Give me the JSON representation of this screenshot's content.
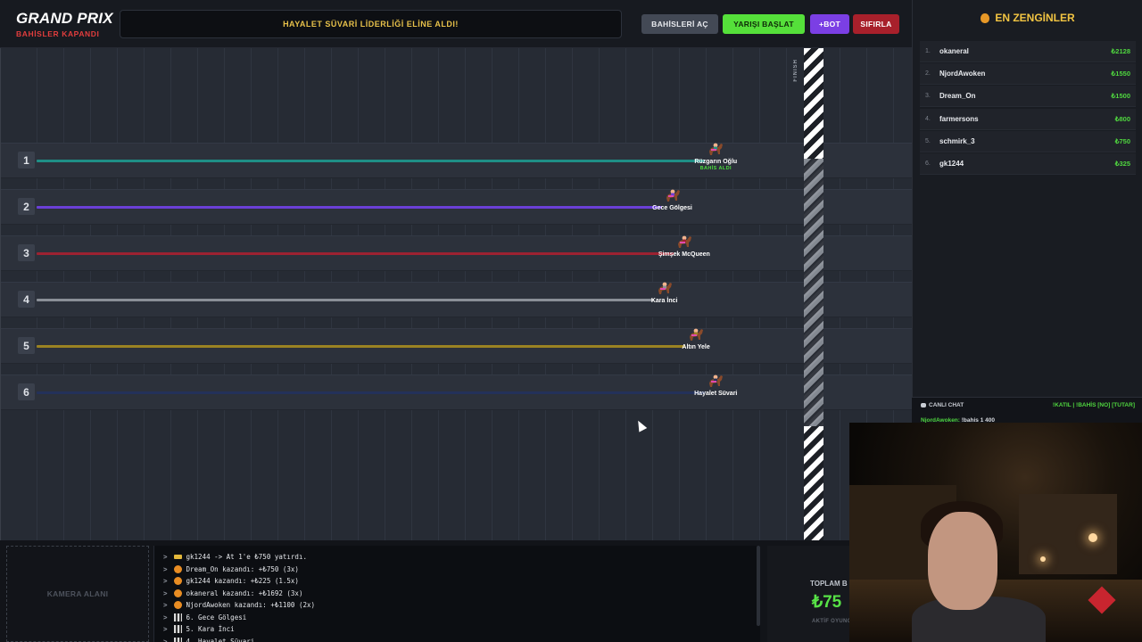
{
  "header": {
    "brand_title": "GRAND PRIX",
    "brand_status": "BAHİSLER KAPANDI",
    "ticker": "HAYALET SÜVARİ LİDERLİĞİ ELİNE ALDI!",
    "buttons": {
      "open_bets": "BAHİSLERİ AÇ",
      "start_race": "YARIŞI BAŞLAT",
      "add_bot": "+BOT",
      "reset": "SIFIRLA"
    }
  },
  "race": {
    "finish_label": "FINISH",
    "progress_note": "progress is fraction of track length reached by each horse",
    "lanes": [
      {
        "number": "1",
        "name": "Rüzgarın Oğlu",
        "tag": "BAHİS ALDI",
        "color": "#1f8f86",
        "progress": 0.875
      },
      {
        "number": "2",
        "name": "Gece Gölgesi",
        "tag": "",
        "color": "#6a3fd6",
        "progress": 0.82
      },
      {
        "number": "3",
        "name": "Şimşek McQueen",
        "tag": "",
        "color": "#9c2231",
        "progress": 0.835
      },
      {
        "number": "4",
        "name": "Kara İnci",
        "tag": "",
        "color": "#8a8f97",
        "progress": 0.81
      },
      {
        "number": "5",
        "name": "Altın Yele",
        "tag": "",
        "color": "#9a8222",
        "progress": 0.85
      },
      {
        "number": "6",
        "name": "Hayalet Süvari",
        "tag": "",
        "color": "#23315a",
        "progress": 0.875
      }
    ]
  },
  "bottom": {
    "camera_area": "KAMERA ALANI",
    "log": [
      {
        "icon": "money-icon",
        "text": "gk1244 -> At 1'e ₺750 yatırdı."
      },
      {
        "icon": "money-bag-icon",
        "text": "Dream_On kazandı: +₺750 (3x)"
      },
      {
        "icon": "money-bag-icon",
        "text": "gk1244 kazandı: +₺225 (1.5x)"
      },
      {
        "icon": "money-bag-icon",
        "text": "okaneral kazandı: +₺1692 (3x)"
      },
      {
        "icon": "money-bag-icon",
        "text": "NjordAwoken kazandı: +₺1100 (2x)"
      },
      {
        "icon": "checkered-flag-icon",
        "text": "6. Gece Gölgesi"
      },
      {
        "icon": "checkered-flag-icon",
        "text": "5. Kara İnci"
      },
      {
        "icon": "checkered-flag-icon",
        "text": "4. Hayalet Süvari"
      }
    ],
    "total_label": "TOPLAM B",
    "total_value": "₺75",
    "total_sub": "AKTİF OYUNC"
  },
  "leaderboard": {
    "title": "EN ZENGİNLER",
    "rows": [
      {
        "rank": "1.",
        "name": "okaneral",
        "value": "₺2128"
      },
      {
        "rank": "2.",
        "name": "NjordAwoken",
        "value": "₺1550"
      },
      {
        "rank": "3.",
        "name": "Dream_On",
        "value": "₺1500"
      },
      {
        "rank": "4.",
        "name": "farmersons",
        "value": "₺800"
      },
      {
        "rank": "5.",
        "name": "schmirk_3",
        "value": "₺750"
      },
      {
        "rank": "6.",
        "name": "gk1244",
        "value": "₺325"
      }
    ]
  },
  "chat": {
    "title": "CANLI CHAT",
    "commands": "!KATIL | !BAHİS [NO] [TUTAR]",
    "message_user": "NjordAwoken:",
    "message_text": " !bahis 1 400"
  }
}
